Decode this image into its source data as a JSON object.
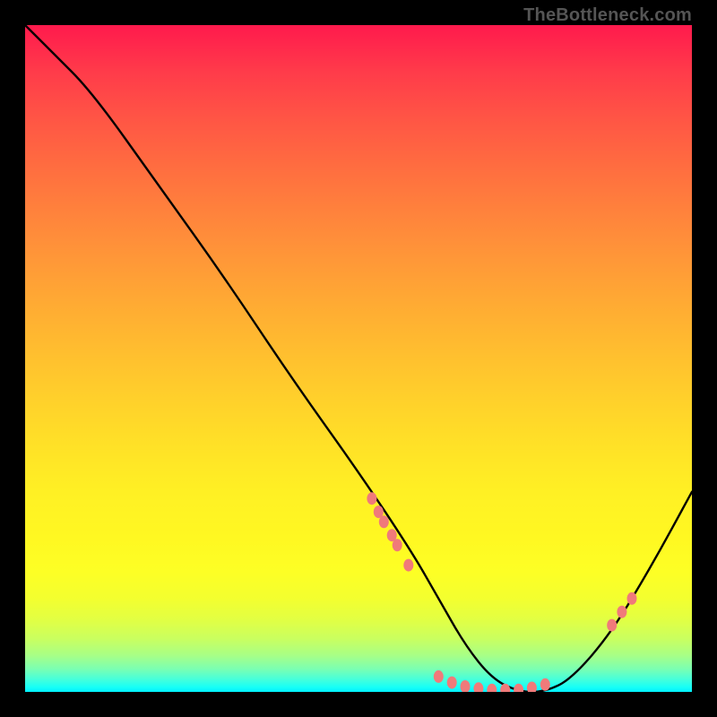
{
  "attribution": "TheBottleneck.com",
  "chart_data": {
    "type": "line",
    "title": "",
    "xlabel": "",
    "ylabel": "",
    "xlim": [
      0,
      100
    ],
    "ylim": [
      0,
      100
    ],
    "grid": false,
    "legend": false,
    "series": [
      {
        "name": "curve",
        "x": [
          0,
          4,
          10,
          20,
          30,
          40,
          50,
          58,
          62,
          66,
          70,
          74,
          78,
          82,
          88,
          94,
          100
        ],
        "y": [
          100,
          96,
          90,
          76,
          62,
          47,
          33,
          21,
          14,
          7,
          2,
          0,
          0,
          2,
          9,
          19,
          30
        ]
      }
    ],
    "markers": [
      {
        "name": "left-cluster",
        "points": [
          {
            "x": 52,
            "y": 29
          },
          {
            "x": 53,
            "y": 27
          },
          {
            "x": 53.8,
            "y": 25.5
          },
          {
            "x": 55,
            "y": 23.5
          },
          {
            "x": 55.8,
            "y": 22
          },
          {
            "x": 57.5,
            "y": 19
          }
        ]
      },
      {
        "name": "floor-cluster",
        "points": [
          {
            "x": 62,
            "y": 2.3
          },
          {
            "x": 64,
            "y": 1.4
          },
          {
            "x": 66,
            "y": 0.8
          },
          {
            "x": 68,
            "y": 0.5
          },
          {
            "x": 70,
            "y": 0.3
          },
          {
            "x": 72,
            "y": 0.3
          },
          {
            "x": 74,
            "y": 0.3
          },
          {
            "x": 76,
            "y": 0.6
          },
          {
            "x": 78,
            "y": 1.1
          }
        ]
      },
      {
        "name": "right-cluster",
        "points": [
          {
            "x": 88,
            "y": 10
          },
          {
            "x": 89.5,
            "y": 12
          },
          {
            "x": 91,
            "y": 14
          }
        ]
      }
    ],
    "colors": {
      "curve": "#000000",
      "marker": "#f07a7a",
      "background_top": "#ff1a4d",
      "background_bottom": "#00f0ff"
    }
  }
}
